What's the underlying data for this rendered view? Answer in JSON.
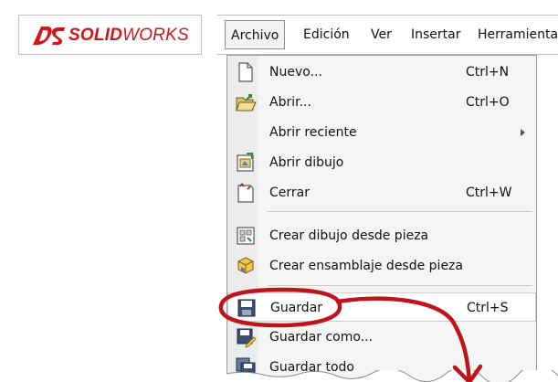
{
  "app": {
    "logo_brand": "SOLID",
    "logo_brand_suffix": "WORKS"
  },
  "menubar": {
    "items": [
      {
        "label": "Archivo"
      },
      {
        "label": "Edición"
      },
      {
        "label": "Ver"
      },
      {
        "label": "Insertar"
      },
      {
        "label": "Herramienta"
      }
    ]
  },
  "file_menu": {
    "items": [
      {
        "label": "Nuevo...",
        "shortcut": "Ctrl+N",
        "icon": "new-document-icon"
      },
      {
        "label": "Abrir...",
        "shortcut": "Ctrl+O",
        "icon": "open-folder-icon"
      },
      {
        "label": "Abrir reciente",
        "has_submenu": true
      },
      {
        "label": "Abrir dibujo",
        "icon": "open-drawing-icon"
      },
      {
        "label": "Cerrar",
        "shortcut": "Ctrl+W",
        "icon": "close-document-icon"
      },
      {
        "label": "Crear dibujo desde pieza",
        "icon": "make-drawing-icon"
      },
      {
        "label": "Crear ensamblaje desde pieza",
        "icon": "make-assembly-icon"
      },
      {
        "label": "Guardar",
        "shortcut": "Ctrl+S",
        "icon": "save-icon",
        "highlighted": true
      },
      {
        "label": "Guardar como...",
        "icon": "save-as-icon"
      },
      {
        "label": "Guardar todo",
        "icon": "save-all-icon"
      }
    ]
  },
  "colors": {
    "brand_red": "#d3151b",
    "annotation_red": "#c0141b",
    "menu_bg": "#f5f5f5"
  }
}
